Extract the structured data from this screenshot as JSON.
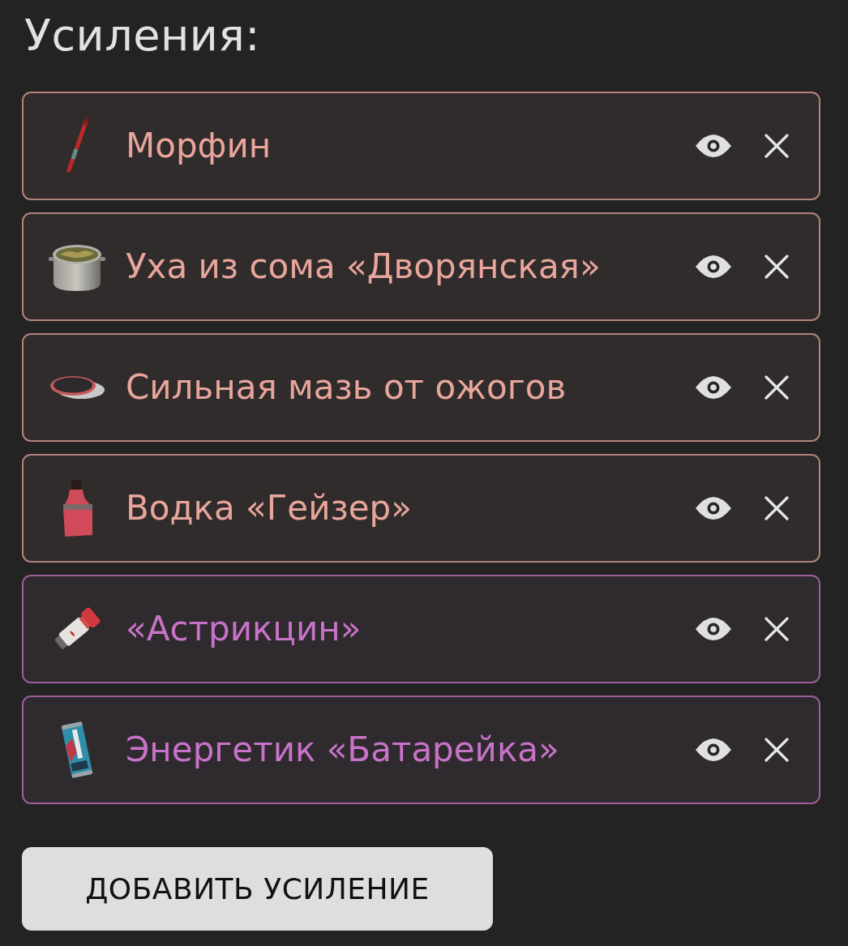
{
  "title": "Усиления:",
  "items": [
    {
      "name": "Морфин",
      "color": "#e8a59c"
    },
    {
      "name": "Уха из сома «Дворянская»",
      "color": "#e8a59c"
    },
    {
      "name": "Сильная мазь от ожогов",
      "color": "#e8a59c"
    },
    {
      "name": "Водка «Гейзер»",
      "color": "#e8a59c"
    },
    {
      "name": "«Астрикцин»",
      "color": "#c873c8"
    },
    {
      "name": "Энергетик «Батарейка»",
      "color": "#c873c8"
    }
  ],
  "add_button": {
    "label": "ДОБАВИТЬ УСИЛЕНИЕ"
  }
}
